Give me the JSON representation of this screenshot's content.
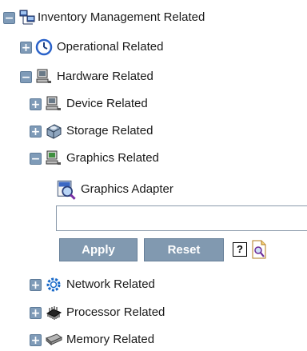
{
  "tree": {
    "root": {
      "label": "Inventory Management Related",
      "toggle": "−",
      "icon": "network-computers-icon"
    },
    "operational": {
      "label": "Operational Related",
      "toggle": "+",
      "icon": "clock-icon"
    },
    "hardware": {
      "label": "Hardware Related",
      "toggle": "−",
      "icon": "computer-icon"
    },
    "device": {
      "label": "Device Related",
      "toggle": "+",
      "icon": "computer-icon"
    },
    "storage": {
      "label": "Storage Related",
      "toggle": "+",
      "icon": "storage-drive-icon"
    },
    "graphics": {
      "label": "Graphics Related",
      "toggle": "−",
      "icon": "computer-monitor-icon"
    },
    "graphics_adapter": {
      "label": "Graphics Adapter",
      "icon": "graphics-adapter-icon"
    },
    "network": {
      "label": "Network Related",
      "toggle": "+",
      "icon": "network-gear-icon"
    },
    "processor": {
      "label": "Processor Related",
      "toggle": "+",
      "icon": "processor-chip-icon"
    },
    "memory": {
      "label": "Memory Related",
      "toggle": "+",
      "icon": "memory-module-icon"
    }
  },
  "filter": {
    "value": "",
    "placeholder": "",
    "apply_label": "Apply",
    "reset_label": "Reset",
    "help_label": "?"
  },
  "colors": {
    "toggle_bg": "#7f9bb8",
    "button_bg": "#8199b0",
    "text": "#1a1a1a"
  }
}
